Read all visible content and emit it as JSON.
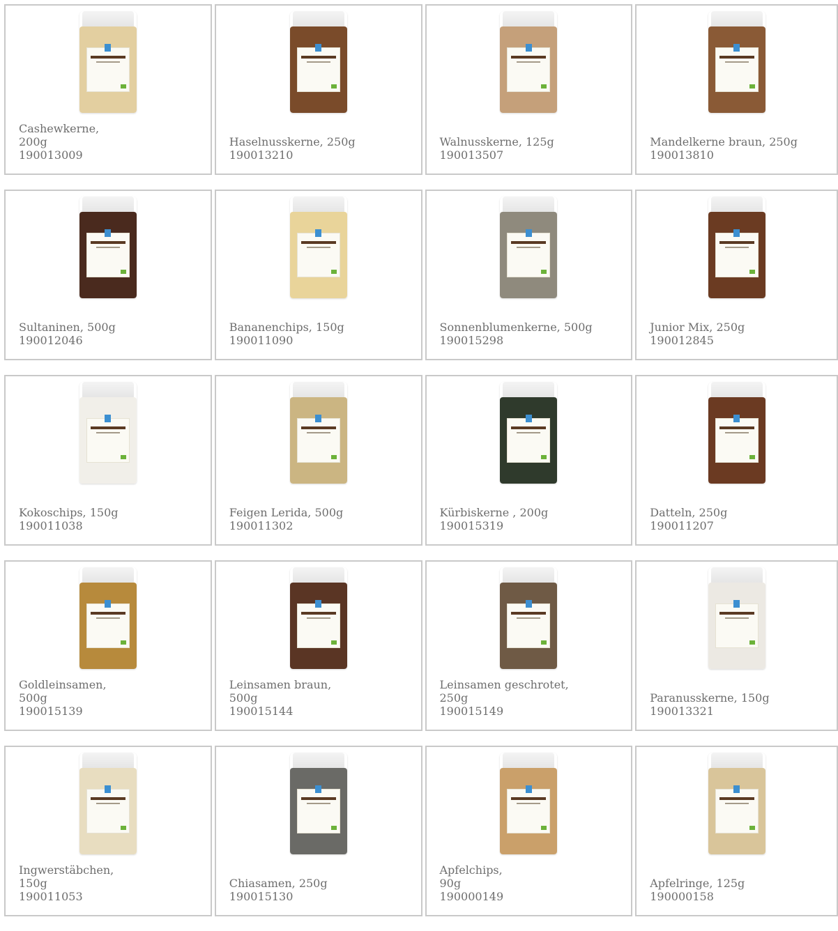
{
  "products": [
    {
      "name": "Cashewkerne,\n200g",
      "sku": "190013009",
      "fill": "#e3cfa0",
      "icon": "product-bag-image"
    },
    {
      "name": "Haselnusskerne, 250g",
      "sku": "190013210",
      "fill": "#7a4b2a",
      "icon": "product-bag-image"
    },
    {
      "name": "Walnusskerne, 125g",
      "sku": "190013507",
      "fill": "#c5a07a",
      "icon": "product-bag-image"
    },
    {
      "name": "Mandelkerne braun, 250g",
      "sku": "190013810",
      "fill": "#8a5a36",
      "icon": "product-bag-image"
    },
    {
      "name": "Sultaninen, 500g",
      "sku": "190012046",
      "fill": "#4a2a1e",
      "icon": "product-bag-image"
    },
    {
      "name": "Bananenchips, 150g",
      "sku": "190011090",
      "fill": "#e9d49a",
      "icon": "product-bag-image"
    },
    {
      "name": "Sonnenblumenkerne, 500g",
      "sku": "190015298",
      "fill": "#8f8a7d",
      "icon": "product-bag-image"
    },
    {
      "name": "Junior Mix, 250g",
      "sku": "190012845",
      "fill": "#6b3b22",
      "icon": "product-bag-image"
    },
    {
      "name": "Kokoschips, 150g",
      "sku": "190011038",
      "fill": "#f1efe9",
      "icon": "product-bag-image"
    },
    {
      "name": "Feigen Lerida, 500g",
      "sku": "190011302",
      "fill": "#cbb582",
      "icon": "product-bag-image"
    },
    {
      "name": "Kürbiskerne , 200g",
      "sku": "190015319",
      "fill": "#2f3a2c",
      "icon": "product-bag-image"
    },
    {
      "name": "Datteln, 250g",
      "sku": "190011207",
      "fill": "#6b3a22",
      "icon": "product-bag-image"
    },
    {
      "name": "Goldleinsamen,\n500g",
      "sku": "190015139",
      "fill": "#b78a3c",
      "icon": "product-bag-image"
    },
    {
      "name": "Leinsamen braun,\n500g",
      "sku": "190015144",
      "fill": "#5a3524",
      "icon": "product-bag-image"
    },
    {
      "name": "Leinsamen geschrotet,\n250g",
      "sku": "190015149",
      "fill": "#6f5a45",
      "icon": "product-bag-image"
    },
    {
      "name": "Paranusskerne, 150g",
      "sku": "190013321",
      "fill": "#ece9e3",
      "icon": "product-bag-image"
    },
    {
      "name": "Ingwerstäbchen,\n150g",
      "sku": "190011053",
      "fill": "#e8ddc0",
      "icon": "product-bag-image"
    },
    {
      "name": "Chiasamen, 250g",
      "sku": "190015130",
      "fill": "#6a6a66",
      "icon": "product-bag-image"
    },
    {
      "name": "Apfelchips,\n90g",
      "sku": "190000149",
      "fill": "#caa06a",
      "icon": "product-bag-image"
    },
    {
      "name": "Apfelringe, 125g",
      "sku": "190000158",
      "fill": "#d9c59a",
      "icon": "product-bag-image"
    }
  ]
}
